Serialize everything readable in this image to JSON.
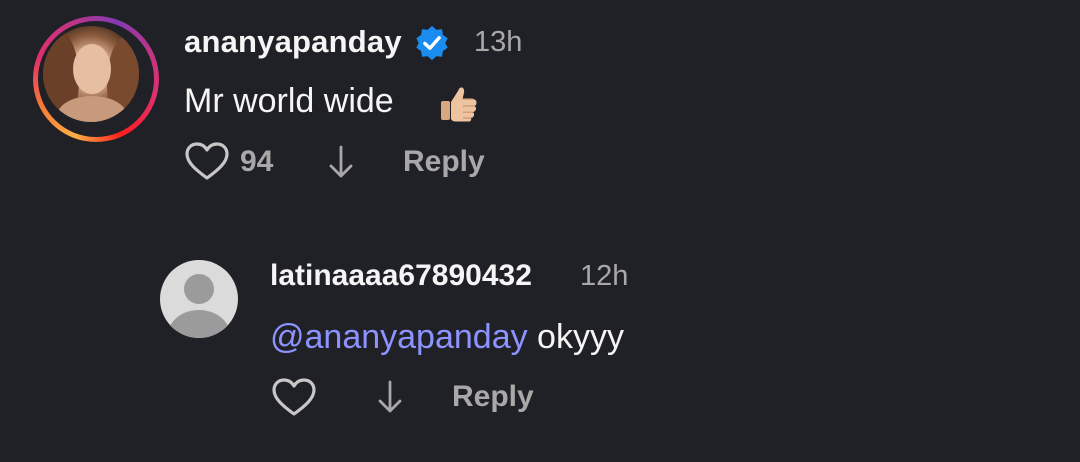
{
  "comment": {
    "username": "ananyapanday",
    "time": "13h",
    "text": "Mr world wide",
    "emoji": "thumbs-up",
    "likes": "94",
    "reply_label": "Reply"
  },
  "reply_comment": {
    "username": "latinaaaa67890432",
    "time": "12h",
    "mention": "@ananyapanday",
    "text": " okyyy",
    "reply_label": "Reply"
  },
  "colors": {
    "background": "#202126",
    "primary_text": "#f5f5f5",
    "secondary_text": "#a8a8a8",
    "mention": "#8c93ff",
    "verified_badge": "#1a8cf0"
  }
}
